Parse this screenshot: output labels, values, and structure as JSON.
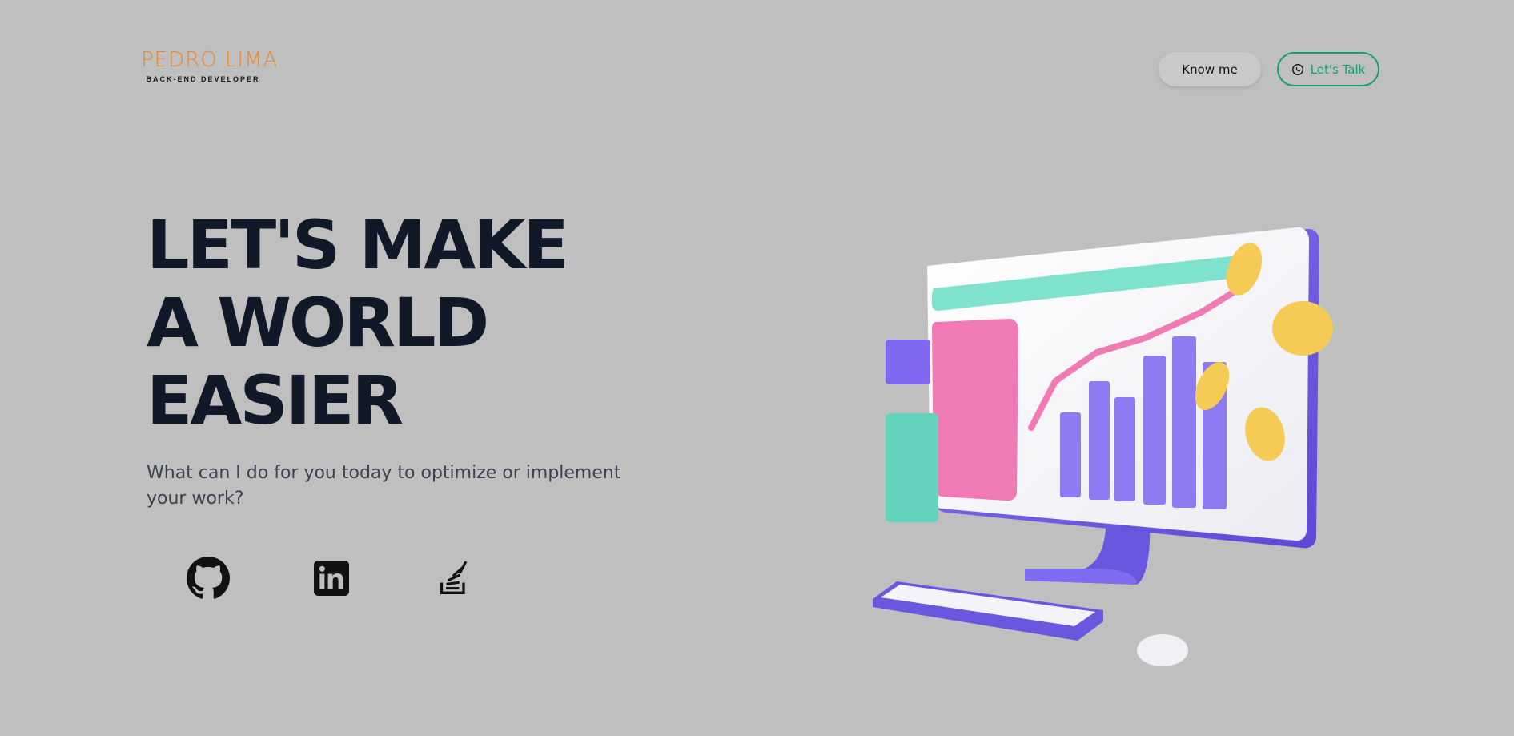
{
  "header": {
    "logo_name": "PEDRO LIMA",
    "logo_tagline": "BACK-END DEVELOPER",
    "know_me_label": "Know me",
    "lets_talk_label": "Let's Talk",
    "lets_talk_icon": "whatsapp-icon"
  },
  "hero": {
    "headline_lines": [
      "LET'S MAKE",
      "A WORLD",
      "EASIER"
    ],
    "subtitle": "What can I do for you today to optimize or implement your work?"
  },
  "social": [
    {
      "icon": "github-icon"
    },
    {
      "icon": "linkedin-icon"
    },
    {
      "icon": "stackoverflow-icon"
    }
  ],
  "colors": {
    "background": "#c0bfc0",
    "logo": "#e58a2c",
    "accent_green": "#14a26b",
    "headline": "#111827"
  }
}
